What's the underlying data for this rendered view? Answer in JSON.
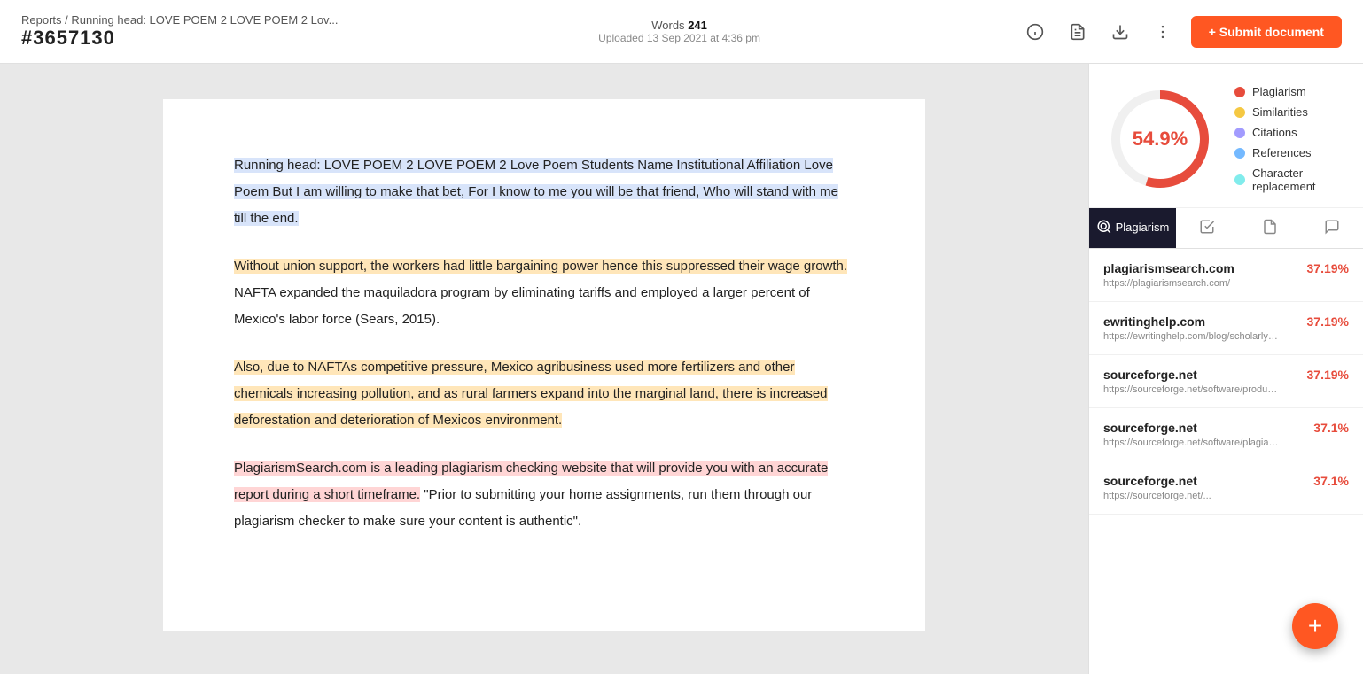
{
  "header": {
    "breadcrumb": "Reports / Running head: LOVE POEM 2 LOVE POEM 2 Lov...",
    "doc_id": "#3657130",
    "words_label": "Words",
    "words_count": "241",
    "upload_info": "Uploaded 13 Sep 2021 at 4:36 pm",
    "submit_label": "+ Submit document"
  },
  "document": {
    "paragraph1": "Running head: LOVE POEM 2 LOVE POEM 2 Love Poem Students Name Institutional Affiliation Love Poem But I am willing to make that bet, For I know to me you will be that friend, Who will stand with me till the end.",
    "paragraph2": "Without union support, the workers had little bargaining power hence this suppressed their wage growth. NAFTA expanded the maquiladora program by eliminating tariffs and employed a larger percent of Mexico's labor force (Sears, 2015).",
    "paragraph3": "Also, due to NAFTAs competitive pressure, Mexico agribusiness used more fertilizers and other chemicals increasing pollution, and as rural farmers expand into the marginal land, there is increased deforestation and deterioration of Mexicos environment.",
    "paragraph4_highlight": "PlagiarismSearch.com is a leading plagiarism checking website that will provide you with an accurate report during a short timeframe.",
    "paragraph4_rest": " \"Prior to submitting your home assignments, run them through our plagiarism checker to make sure your content is authentic\"."
  },
  "score": {
    "percentage": "54.9%",
    "legend": [
      {
        "label": "Plagiarism",
        "color": "#e74c3c"
      },
      {
        "label": "Similarities",
        "color": "#f5c842"
      },
      {
        "label": "Citations",
        "color": "#a29bfe"
      },
      {
        "label": "References",
        "color": "#74b9ff"
      },
      {
        "label": "Character replacement",
        "color": "#81ecec"
      }
    ]
  },
  "tabs": [
    {
      "id": "plagiarism",
      "label": "Plagiarism",
      "active": true
    },
    {
      "id": "sources",
      "label": "Sources"
    },
    {
      "id": "pages",
      "label": "Pages"
    },
    {
      "id": "comments",
      "label": "Comments"
    }
  ],
  "sources": [
    {
      "name": "plagiarismsearch.com",
      "url": "https://plagiarismsearch.com/",
      "pct": "37.19%"
    },
    {
      "name": "ewritinghelp.com",
      "url": "https://ewritinghelp.com/blog/scholarly-writing-and-...",
      "pct": "37.19%"
    },
    {
      "name": "sourceforge.net",
      "url": "https://sourceforge.net/software/product/Plagiarism...",
      "pct": "37.19%"
    },
    {
      "name": "sourceforge.net",
      "url": "https://sourceforge.net/software/plagiarism-checker...",
      "pct": "37.1%"
    },
    {
      "name": "sourceforge.net",
      "url": "https://sourceforge.net/...",
      "pct": "37.1%"
    }
  ],
  "fab": {
    "label": "+"
  }
}
